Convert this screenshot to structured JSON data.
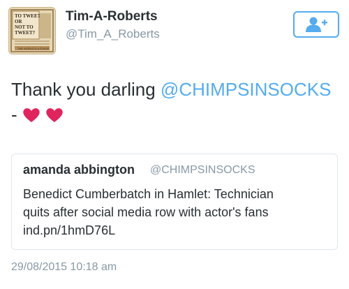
{
  "user": {
    "display_name": "Tim-A-Roberts",
    "handle": "@Tim_A_Roberts",
    "avatar_text": [
      "TO TWEET",
      "OR",
      "NOT TO",
      "TWEET?",
      "THE WORLD'S A STAGE"
    ]
  },
  "follow_button": {
    "icon": "add-user-icon",
    "color": "#55acee"
  },
  "tweet": {
    "text_prefix": "Thank you darling",
    "mention": "@CHIMPSINSOCKS",
    "text_suffix": "-",
    "emoji": [
      "heart",
      "heart"
    ]
  },
  "quoted_tweet": {
    "display_name": "amanda abbington",
    "handle": "@CHIMPSINSOCKS",
    "text_line1": "Benedict Cumberbatch in Hamlet: Technician",
    "text_line2": "quits after social media row with actor's fans",
    "text_line3": "ind.pn/1hmD76L"
  },
  "timestamp": "29/08/2015 10:18 am",
  "colors": {
    "link": "#55acee",
    "secondary": "#8899a6",
    "text": "#292f33",
    "border": "#e1e8ed",
    "heart": "#e0245e"
  }
}
